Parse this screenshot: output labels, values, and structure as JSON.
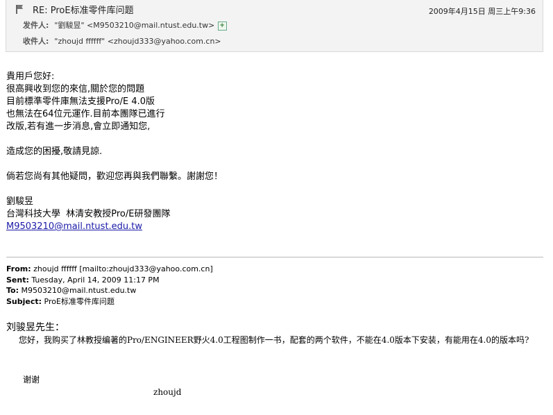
{
  "header": {
    "subject": "RE: ProE标准零件库问题",
    "date": "2009年4月15日 周三上午9:36",
    "from_label": "发件人:",
    "from_value": "\"劉駿昱\" <M9503210@mail.ntust.edu.tw>",
    "to_label": "收件人:",
    "to_value": "\"zhoujd ffffff\" <zhoujd333@yahoo.com.cn>",
    "icons": [
      "flag-icon",
      "add-contact-icon"
    ]
  },
  "body": {
    "lines": [
      "貴用戶您好:",
      "很高興收到您的來信,關於您的問題",
      "目前標準零件庫無法支援Pro/E 4.0版",
      "也無法在64位元運作.目前本團隊已進行",
      "改版,若有進一步消息,會立即通知您,",
      "",
      "造成您的困擾,敬請見諒.",
      "",
      "倘若您尚有其他疑問，歡迎您再與我們聯繫。謝謝您！",
      "",
      "劉駿昱",
      "台灣科技大學  林清安教授Pro/E研發團隊"
    ],
    "email_link": "M9503210@mail.ntust.edu.tw"
  },
  "original": {
    "from_label": "From:",
    "from_value": " zhoujd ffffff [mailto:zhoujd333@yahoo.com.cn]",
    "sent_label": "Sent:",
    "sent_value": " Tuesday, April 14, 2009 11:17 PM",
    "to_label": "To:",
    "to_value": " M9503210@mail.ntust.edu.tw",
    "subject_label": "Subject:",
    "subject_value": " ProE标准零件库问题"
  },
  "reply": {
    "greeting": "刘骏昱先生：",
    "paragraph": "您好，我购买了林教授编著的Pro/ENGINEER野火4.0工程图制作一书，配套的两个软件，不能在4.0版本下安装，有能用在4.0的版本吗?",
    "thanks": "谢谢",
    "signoff": "zhoujd"
  }
}
